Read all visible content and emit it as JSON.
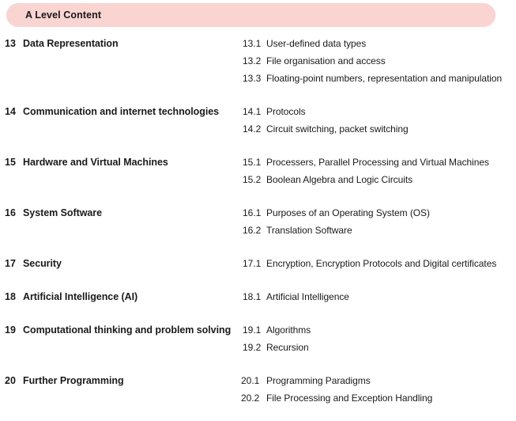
{
  "banner": {
    "title": "A Level Content",
    "color": "#f9d4d1"
  },
  "text_color": "#1a1a1a",
  "background": "#ffffff",
  "units": [
    {
      "number": "13",
      "title": "Data Representation",
      "subtopics": [
        {
          "number": "13.1",
          "label": "User-defined data types"
        },
        {
          "number": "13.2",
          "label": "File organisation and access"
        },
        {
          "number": "13.3",
          "label": "Floating-point numbers, representation and manipulation"
        }
      ]
    },
    {
      "number": "14",
      "title": "Communication and internet technologies",
      "subtopics": [
        {
          "number": "14.1",
          "label": "Protocols"
        },
        {
          "number": "14.2",
          "label": "Circuit switching, packet switching"
        }
      ]
    },
    {
      "number": "15",
      "title": "Hardware and Virtual Machines",
      "subtopics": [
        {
          "number": "15.1",
          "label": "Processers, Parallel Processing and Virtual Machines"
        },
        {
          "number": "15.2",
          "label": "Boolean Algebra and Logic Circuits"
        }
      ]
    },
    {
      "number": "16",
      "title": "System Software",
      "subtopics": [
        {
          "number": "16.1",
          "label": "Purposes of an Operating System (OS)"
        },
        {
          "number": "16.2",
          "label": "Translation Software"
        }
      ]
    },
    {
      "number": "17",
      "title": "Security",
      "subtopics": [
        {
          "number": "17.1",
          "label": "Encryption, Encryption Protocols and Digital certificates"
        }
      ]
    },
    {
      "number": "18",
      "title": "Artificial Intelligence (AI)",
      "subtopics": [
        {
          "number": "18.1",
          "label": "Artificial Intelligence"
        }
      ]
    },
    {
      "number": "19",
      "title": "Computational thinking and problem solving",
      "subtopics": [
        {
          "number": "19.1",
          "label": "Algorithms"
        },
        {
          "number": "19.2",
          "label": "Recursion"
        }
      ]
    },
    {
      "number": "20",
      "title": "Further Programming",
      "subtopics": [
        {
          "number": "20.1",
          "label": "Programming Paradigms"
        },
        {
          "number": "20.2",
          "label": "File Processing and Exception Handling"
        }
      ]
    }
  ]
}
